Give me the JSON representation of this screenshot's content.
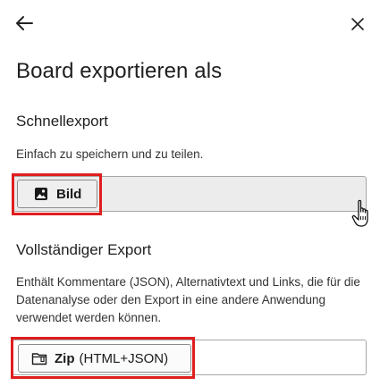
{
  "dialog": {
    "title": "Board exportieren als",
    "quick_export": {
      "heading": "Schnellexport",
      "description": "Einfach zu speichern und zu teilen.",
      "button_label": "Bild",
      "button_icon": "image-icon"
    },
    "full_export": {
      "heading": "Vollständiger Export",
      "description": "Enthält Kommentare (JSON), Alternativtext und Links, die für die Datenanalyse oder den Export in eine andere Anwendung verwendet werden können.",
      "button_label_strong": "Zip",
      "button_label_rest": "(HTML+JSON)",
      "button_icon": "zip-folder-icon"
    }
  },
  "colors": {
    "highlight": "#e01e1e",
    "text": "#1f1f1f",
    "border": "#a7a7a7"
  },
  "icons": {
    "back": "arrow-left-icon",
    "close": "close-icon",
    "cursor": "hand-pointer-icon"
  }
}
